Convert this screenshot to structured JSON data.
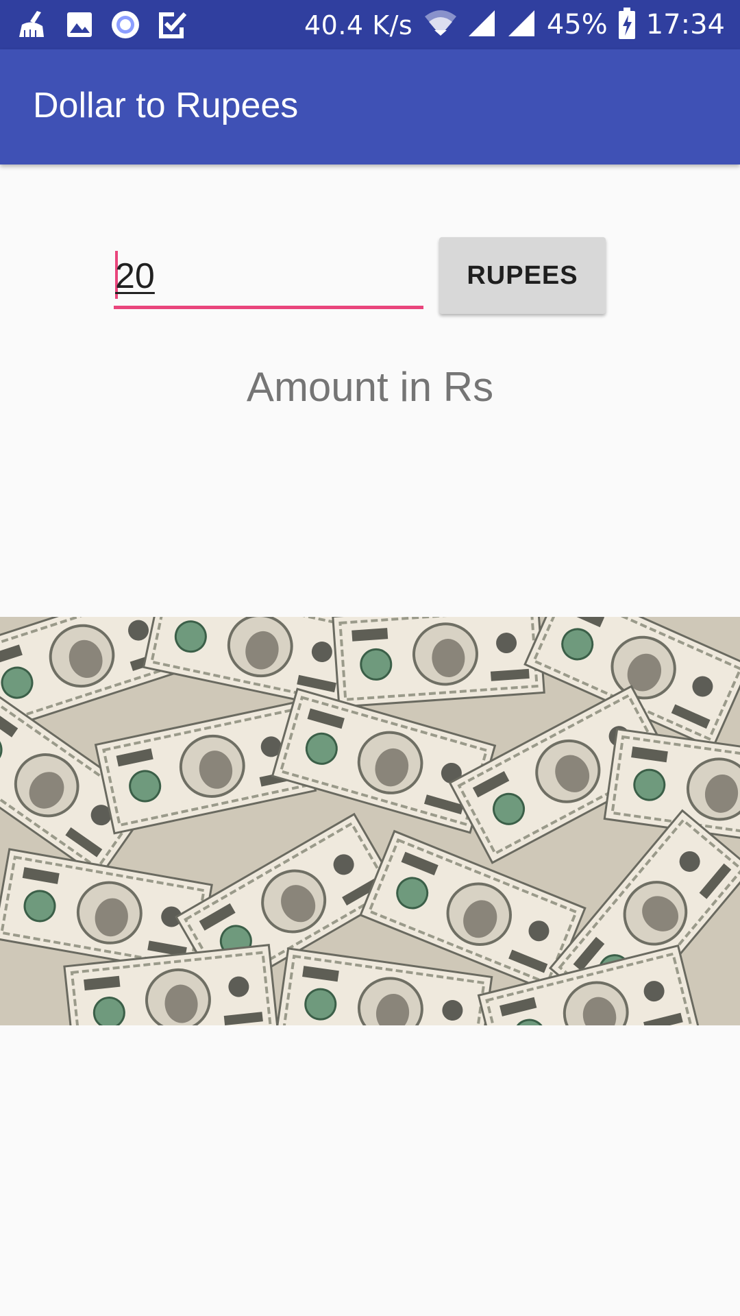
{
  "status_bar": {
    "network_speed": "40.4 K/s",
    "battery_percent": "45%",
    "time": "17:34",
    "left_icons": [
      "cleaner-icon",
      "image-icon",
      "circle-notification-icon",
      "task-check-icon"
    ],
    "right_icons": [
      "wifi-icon",
      "signal-icon",
      "signal-icon",
      "battery-charging-icon"
    ]
  },
  "app_bar": {
    "title": "Dollar to Rupees"
  },
  "form": {
    "amount_value": "20",
    "convert_button_label": "RUPEES"
  },
  "result": {
    "label": "Amount in Rs"
  },
  "image": {
    "subject": "pile of hundred dollar bills"
  },
  "colors": {
    "status_bar": "#303f9f",
    "app_bar": "#3f51b5",
    "accent": "#e9457c",
    "background": "#fafafa",
    "button": "#d8d8d8"
  }
}
